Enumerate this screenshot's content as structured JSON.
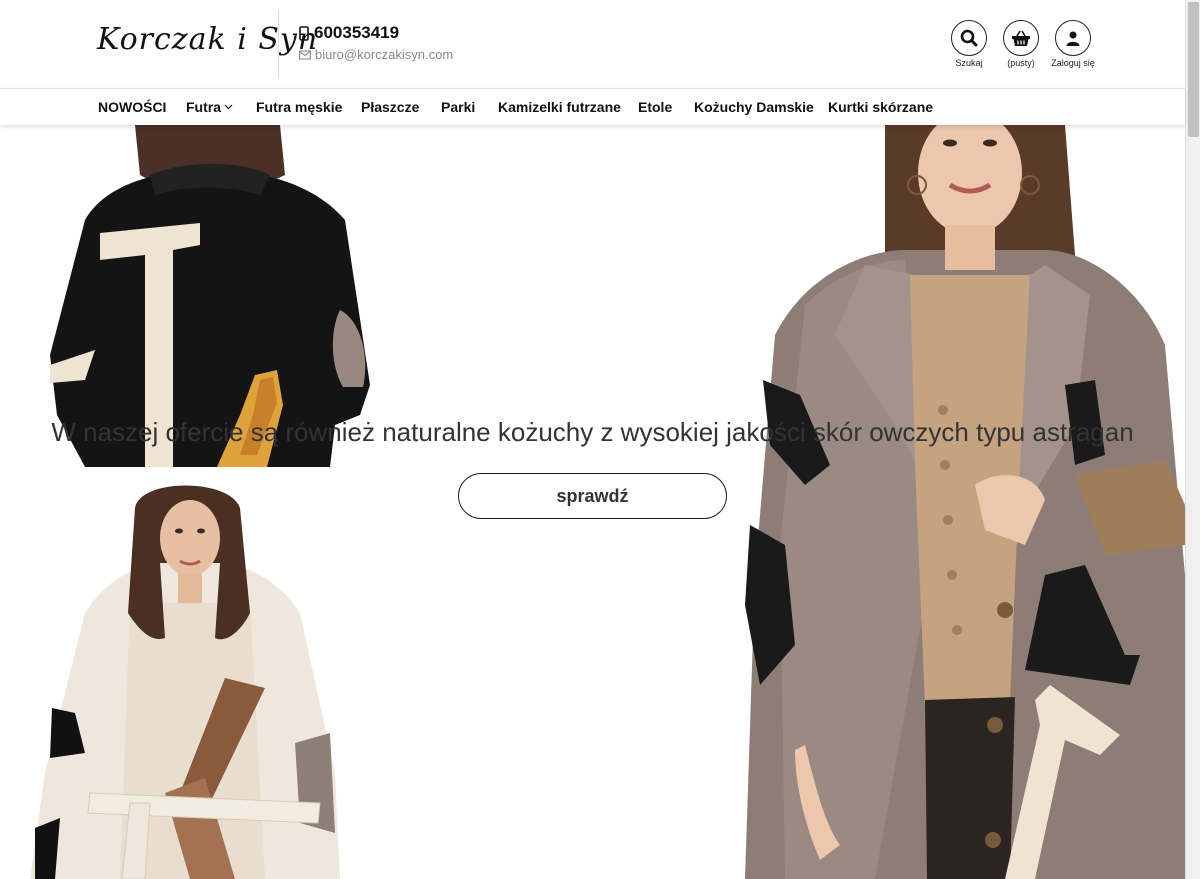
{
  "header": {
    "logo_text": "Korczak i Syn",
    "phone": "600353419",
    "email": "biuro@korczakisyn.com",
    "icons": [
      {
        "icon": "search-icon",
        "label": "Szukaj"
      },
      {
        "icon": "basket-icon",
        "label": "(pusty)"
      },
      {
        "icon": "user-icon",
        "label": "Zaloguj się"
      }
    ]
  },
  "nav": {
    "items": [
      {
        "label": "NOWOŚCI"
      },
      {
        "label": "Futra"
      },
      {
        "label": "Futra męskie"
      },
      {
        "label": "Płaszcze"
      },
      {
        "label": "Parki"
      },
      {
        "label": "Kamizelki futrzane"
      },
      {
        "label": "Etole"
      },
      {
        "label": "Kożuchy Damskie"
      },
      {
        "label": "Kurtki skórzane"
      }
    ]
  },
  "hero": {
    "headline": "W naszej ofercie są również naturalne kożuchy z wysokiej jakości skór owczych typu astragan",
    "cta_label": "sprawdź"
  },
  "colors": {
    "text": "#111111",
    "muted": "#888888",
    "border": "#222222"
  }
}
